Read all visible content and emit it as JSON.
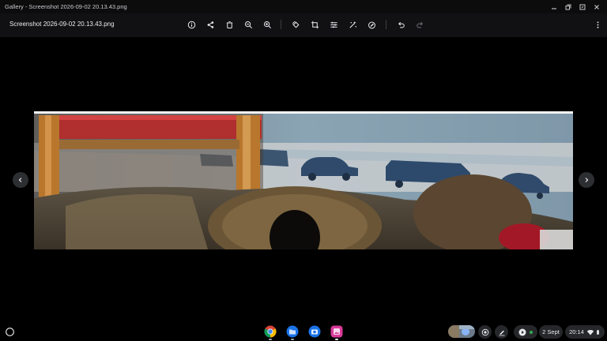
{
  "window": {
    "title": "Gallery - Screenshot 2026-09-02 20.13.43.png",
    "controls": [
      "minimize-icon",
      "restore-icon",
      "fullscreen-icon",
      "close-icon"
    ]
  },
  "toolbar": {
    "filename": "Screenshot 2026-09-02 20.13.43.png",
    "actions": [
      "info-icon",
      "share-icon",
      "delete-icon",
      "zoom-out-icon",
      "zoom-in-icon",
      "rotate-icon",
      "crop-icon",
      "adjust-icon",
      "lighting-filters-icon",
      "annotate-icon",
      "undo-icon",
      "redo-icon",
      "more-icon"
    ]
  },
  "viewer": {
    "prev": "chevron-left-icon",
    "next": "chevron-right-icon"
  },
  "shelf": {
    "apps": [
      "chrome",
      "files",
      "camera",
      "gallery"
    ],
    "date": "2 Sept",
    "time": "20:14",
    "accent": "#8ab4f8"
  }
}
